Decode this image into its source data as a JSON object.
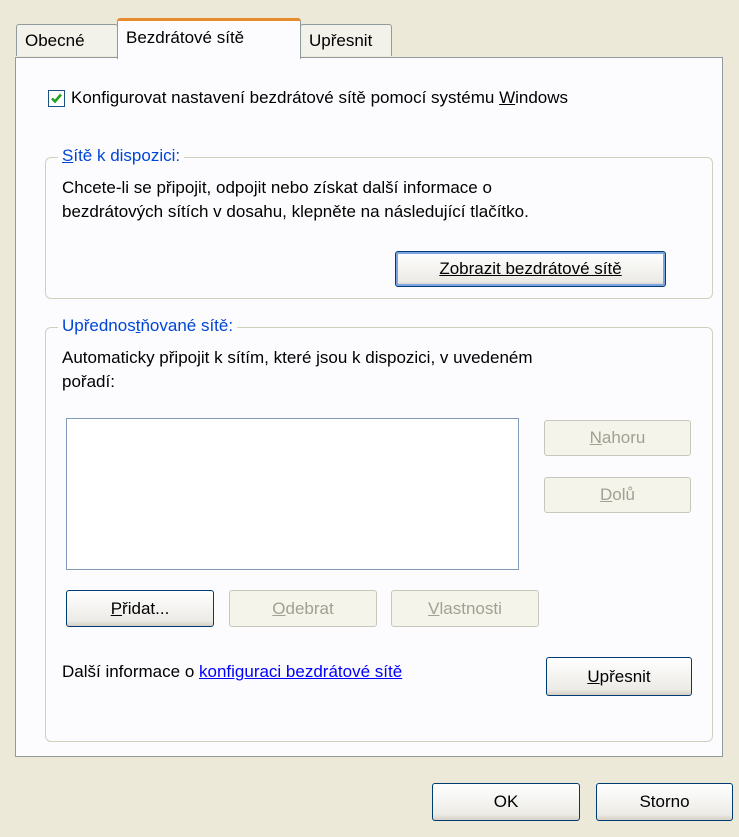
{
  "tabs": [
    {
      "label": "Obecné",
      "active": false
    },
    {
      "label": "Bezdrátové sítě",
      "active": true
    },
    {
      "label": "Upřesnit",
      "active": false
    }
  ],
  "configure_checkbox": {
    "checked": true,
    "label_pre": "Konfigurovat nastavení bezdrátové sítě pomocí systému ",
    "label_key": "W",
    "label_post": "indows"
  },
  "available": {
    "legend_key": "S",
    "legend_rest": "ítě k dispozici:",
    "desc_line1": "Chcete-li se připojit, odpojit nebo získat další informace o",
    "desc_line2": "bezdrátových sítích v dosahu, klepněte na následující tlačítko.",
    "view_button": "Zobrazit bezdrátové sítě"
  },
  "preferred": {
    "legend_pre": "Upřednos",
    "legend_key": "t",
    "legend_post": "ňované sítě:",
    "desc_line1": "Automaticky připojit k sítím, které jsou k dispozici, v uvedeném",
    "desc_line2": "pořadí:",
    "up_key": "N",
    "up_rest": "ahoru",
    "down_key": "D",
    "down_rest": "olů",
    "add_key": "P",
    "add_rest": "řidat...",
    "remove_key": "O",
    "remove_rest": "debrat",
    "properties_key": "V",
    "properties_rest": "lastnosti",
    "info_text": "Další informace o ",
    "info_link": "konfiguraci bezdrátové sítě",
    "advanced_key": "U",
    "advanced_rest": "přesnit"
  },
  "footer": {
    "ok": "OK",
    "cancel": "Storno"
  }
}
